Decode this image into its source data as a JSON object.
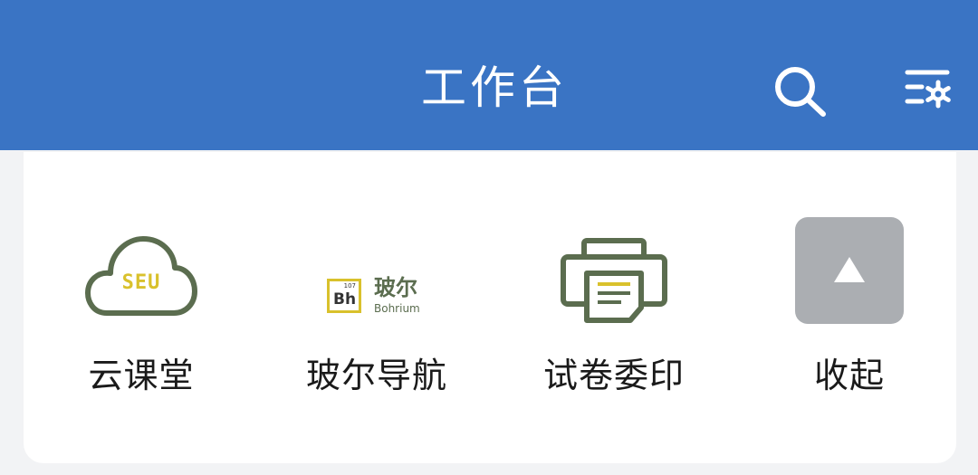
{
  "header": {
    "title": "工作台"
  },
  "apps": [
    {
      "label": "云课堂",
      "icon": "seu-cloud-icon",
      "logo_text": "SEU"
    },
    {
      "label": "玻尔导航",
      "icon": "bohrium-logo-icon",
      "logo_text": "玻尔",
      "logo_subtext": "Bohrium",
      "logo_symbol": "Bh",
      "logo_number": "107"
    },
    {
      "label": "试卷委印",
      "icon": "printer-icon"
    },
    {
      "label": "收起",
      "icon": "collapse-up-icon"
    }
  ],
  "colors": {
    "header_bg": "#3a74c4",
    "icon_green": "#5b6d4f",
    "logo_yellow": "#d9c12c",
    "collapse_tile": "#abaeb2"
  }
}
